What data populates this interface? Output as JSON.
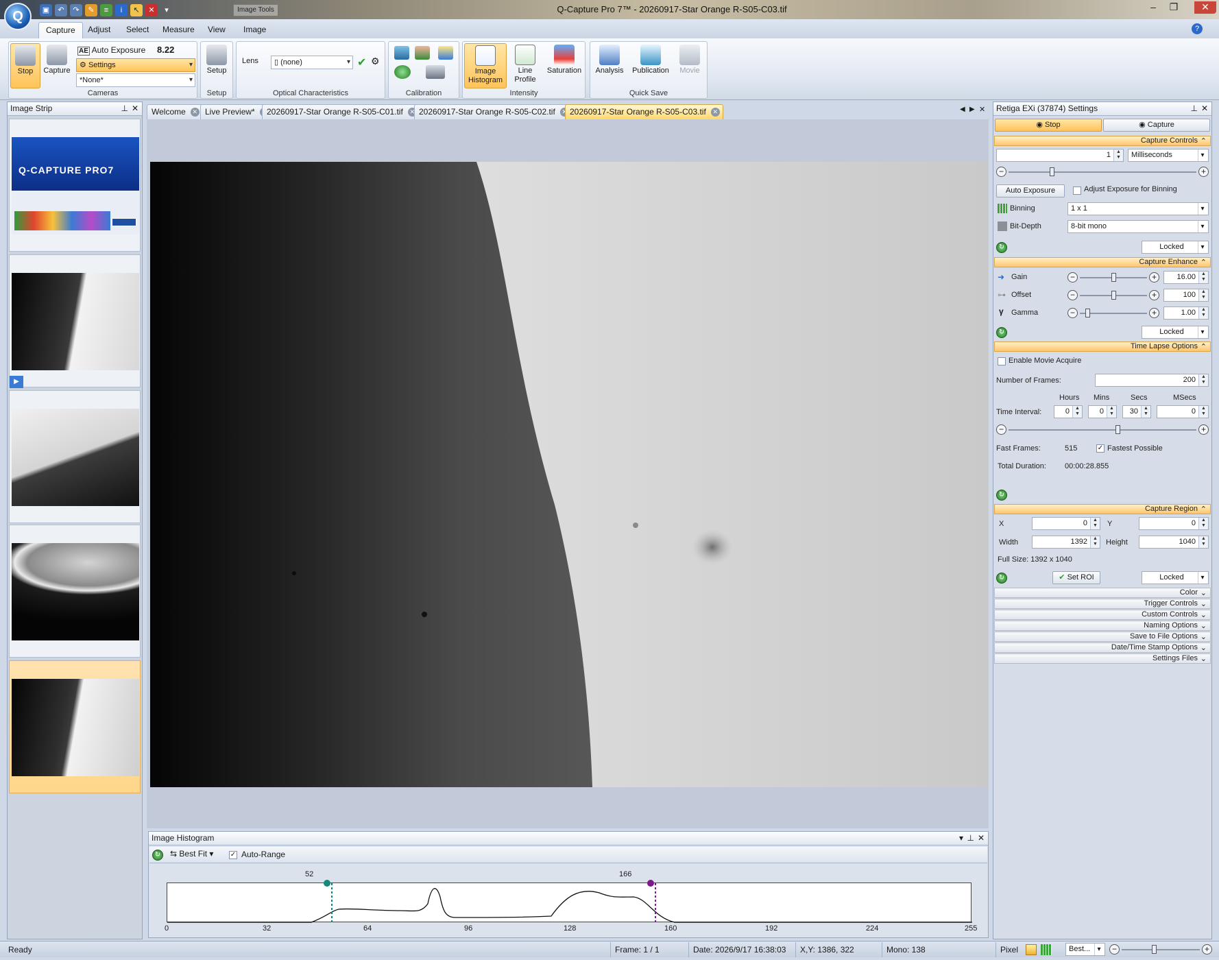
{
  "window": {
    "title": "Q-Capture Pro 7™ - 20260917-Star Orange R-S05-C03.tif",
    "contextual_tab_group": "Image Tools"
  },
  "ribbon": {
    "tabs": [
      "Capture",
      "Adjust",
      "Select",
      "Measure",
      "View",
      "Image"
    ],
    "active_tab": "Capture",
    "cameras": {
      "stop": "Stop",
      "capture": "Capture",
      "auto_exposure": "Auto Exposure",
      "fps": "8.22 FPS",
      "settings": "Settings",
      "preset": "*None*",
      "group": "Cameras"
    },
    "setup": {
      "button": "Setup",
      "group": "Setup"
    },
    "optical": {
      "lens_label": "Lens",
      "lens_value": "(none)",
      "group": "Optical Characteristics"
    },
    "calibration": {
      "group": "Calibration"
    },
    "intensity": {
      "image_histogram": "Image Histogram",
      "line_profile": "Line Profile",
      "saturation": "Saturation",
      "group": "Intensity"
    },
    "quick_save": {
      "analysis": "Analysis",
      "publication": "Publication",
      "movie": "Movie",
      "group": "Quick Save"
    }
  },
  "image_strip": {
    "title": "Image Strip",
    "logo_text": "Q-CAPTURE PRO7"
  },
  "doc_tabs": [
    "Welcome",
    "Live Preview*",
    "20260917-Star Orange R-S05-C01.tif",
    "20260917-Star Orange R-S05-C02.tif",
    "20260917-Star Orange R-S05-C03.tif"
  ],
  "active_doc_tab": "20260917-Star Orange R-S05-C03.tif",
  "histogram": {
    "title": "Image Histogram",
    "fit_mode": "Best Fit",
    "auto_range": "Auto-Range",
    "low_marker": "52",
    "high_marker": "166",
    "ticks": [
      "0",
      "32",
      "64",
      "96",
      "128",
      "160",
      "192",
      "224",
      "255"
    ]
  },
  "settings": {
    "title": "Retiga EXi (37874) Settings",
    "stop": "Stop",
    "capture": "Capture",
    "capture_controls": {
      "header": "Capture Controls",
      "exposure_value": "1",
      "exposure_unit": "Milliseconds",
      "auto_exposure": "Auto Exposure",
      "adjust_binning": "Adjust Exposure for Binning",
      "binning_label": "Binning",
      "binning_value": "1 x 1",
      "bitdepth_label": "Bit-Depth",
      "bitdepth_value": "8-bit mono",
      "locked": "Locked"
    },
    "capture_enhance": {
      "header": "Capture Enhance",
      "gain_label": "Gain",
      "gain_value": "16.00",
      "offset_label": "Offset",
      "offset_value": "100",
      "gamma_label": "Gamma",
      "gamma_value": "1.00",
      "locked": "Locked"
    },
    "time_lapse": {
      "header": "Time Lapse Options",
      "enable_movie": "Enable Movie Acquire",
      "frames_label": "Number of  Frames:",
      "frames_value": "200",
      "col_hours": "Hours",
      "col_mins": "Mins",
      "col_secs": "Secs",
      "col_msecs": "MSecs",
      "interval_label": "Time Interval:",
      "hours": "0",
      "mins": "0",
      "secs": "30",
      "msecs": "0",
      "fast_frames_label": "Fast Frames:",
      "fast_frames_value": "515",
      "fastest_possible": "Fastest Possible",
      "total_duration_label": "Total Duration:",
      "total_duration_value": "00:00:28.855"
    },
    "capture_region": {
      "header": "Capture Region",
      "x_label": "X",
      "x_value": "0",
      "y_label": "Y",
      "y_value": "0",
      "width_label": "Width",
      "width_value": "1392",
      "height_label": "Height",
      "height_value": "1040",
      "full_size": "Full Size: 1392 x 1040",
      "set_roi": "Set ROI",
      "locked": "Locked"
    },
    "collapsed_sections": [
      "Color",
      "Trigger Controls",
      "Custom Controls",
      "Naming Options",
      "Save to File Options",
      "Date/Time Stamp Options",
      "Settings Files"
    ]
  },
  "status": {
    "ready": "Ready",
    "frame": "Frame: 1 / 1",
    "date": "Date: 2026/9/17 16:38:03",
    "xy": "X,Y: 1386,  322",
    "mono": "Mono:  138",
    "pixel": "Pixel",
    "zoom": "Best..."
  },
  "colors": {
    "accent": "#ffc35a",
    "selection": "#ffd76a",
    "panel": "#d6dde8"
  }
}
